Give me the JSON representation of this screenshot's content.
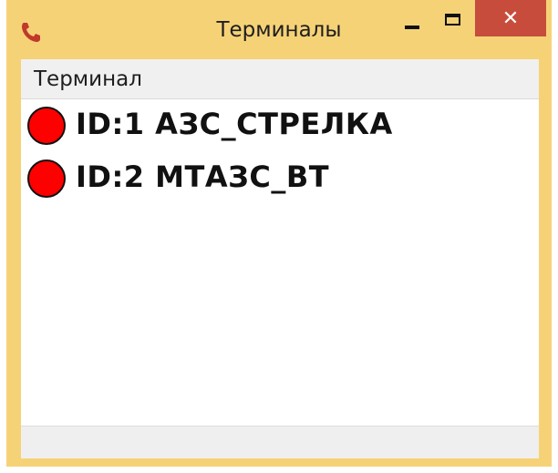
{
  "window": {
    "title": "Терминалы",
    "close_glyph": "✕",
    "icons": {
      "app": "phone-icon",
      "minimize": "minimize-icon",
      "maximize": "maximize-icon",
      "close": "close-icon"
    },
    "colors": {
      "titlebar": "#f6d277",
      "close_button": "#c74c3c",
      "status_dot": "#ff0000"
    }
  },
  "list": {
    "column_header": "Терминал",
    "items": [
      {
        "label": "ID:1 АЗС_СТРЕЛКА",
        "status": "red"
      },
      {
        "label": "ID:2 МТАЗС_ВТ",
        "status": "red"
      }
    ]
  },
  "statusbar": {
    "text": ""
  }
}
